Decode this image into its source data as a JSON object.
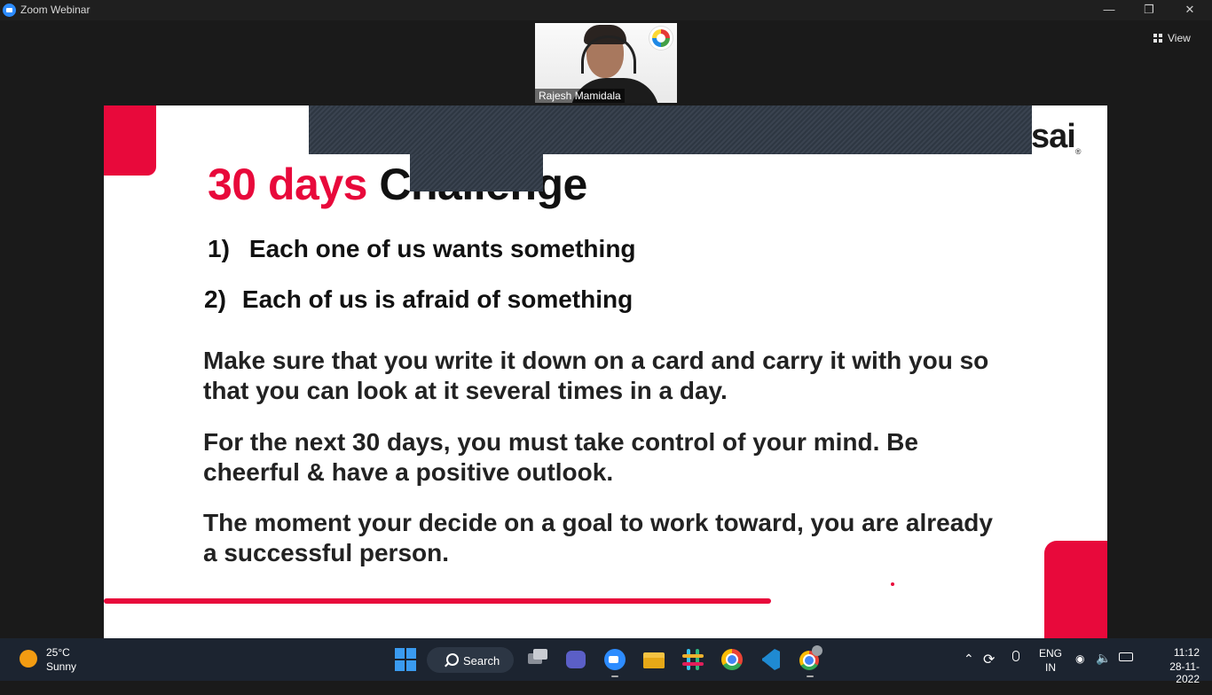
{
  "window": {
    "title": "Zoom Webinar",
    "minimize_icon": "minimize-icon",
    "maximize_icon": "restore-icon",
    "close_icon": "close-icon"
  },
  "view_button": {
    "label": "View",
    "icon": "grid-icon"
  },
  "video": {
    "participant_name": "Rajesh Mamidala"
  },
  "slide": {
    "brand": {
      "text": "sai",
      "registered": "®"
    },
    "heading_accent": "30 days",
    "heading_rest": "Challenge",
    "points": [
      {
        "num": "1)",
        "text": "Each one of us wants something"
      },
      {
        "num": "2)",
        "text": "Each of us is afraid of something"
      }
    ],
    "paragraphs": [
      "Make sure that you write it down on a card and carry it with you so that you can look at it several times in a day.",
      "For the next 30 days, you must take control of your mind. Be cheerful & have a positive outlook.",
      "The moment your decide on a goal to work toward, you are already a successful person."
    ],
    "accent_color": "#e8093b"
  },
  "taskbar": {
    "weather": {
      "temp": "25°C",
      "desc": "Sunny",
      "icon": "sun-icon"
    },
    "search_label": "Search",
    "apps": [
      "windows-start-icon",
      "task-view-icon",
      "teams-chat-icon",
      "zoom-icon",
      "file-explorer-icon",
      "slack-icon",
      "chrome-icon",
      "vscode-icon",
      "chrome-profile-icon"
    ],
    "tray": {
      "language_line1": "ENG",
      "language_line2": "IN",
      "time": "11:12",
      "date": "28-11-2022"
    }
  }
}
